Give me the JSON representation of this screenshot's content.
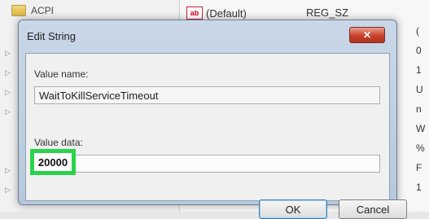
{
  "registry": {
    "tree_top_item": "ACPI",
    "default_value_name": "(Default)",
    "default_value_type": "REG_SZ",
    "right_column_chars": [
      "(",
      "0",
      "1",
      "U",
      "n",
      "W",
      "%",
      "F",
      "1"
    ]
  },
  "dialog": {
    "title": "Edit String",
    "close_symbol": "✕",
    "value_name_label": "Value name:",
    "value_name": "WaitToKillServiceTimeout",
    "value_data_label": "Value data:",
    "value_data": "20000",
    "ok_label": "OK",
    "cancel_label": "Cancel"
  },
  "colors": {
    "highlight": "#2bd34a",
    "close_button": "#c7412c"
  }
}
